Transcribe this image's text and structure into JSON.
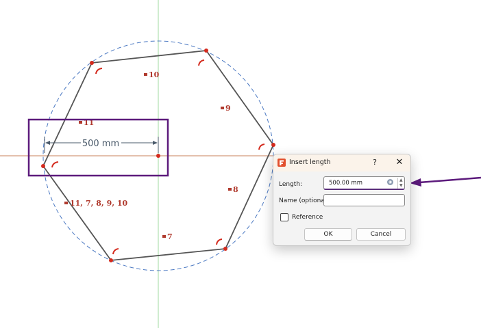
{
  "sketch": {
    "dimension_label": "500 mm",
    "constraints": [
      "10",
      "11",
      "9",
      "8",
      "11, 7, 8, 9, 10",
      "7"
    ],
    "colors": {
      "edge": "#555555",
      "vertex": "#d42a1d",
      "construction_circle": "#4a78c2",
      "axis_vertical": "#9fd89f",
      "axis_horizontal": "#c9805a",
      "highlight": "#5c1a7c",
      "arrow": "#5c1a7c",
      "constraint": "#b03a2e"
    }
  },
  "dialog": {
    "title": "Insert length",
    "help_label": "?",
    "close_label": "✕",
    "length_label": "Length:",
    "length_value": "500.00 mm",
    "expression_icon": "expression-icon",
    "spin_up": "▲",
    "spin_down": "▼",
    "name_label": "Name (optional)",
    "name_value": "",
    "reference_label": "Reference",
    "reference_checked": false,
    "ok_label": "OK",
    "cancel_label": "Cancel"
  }
}
